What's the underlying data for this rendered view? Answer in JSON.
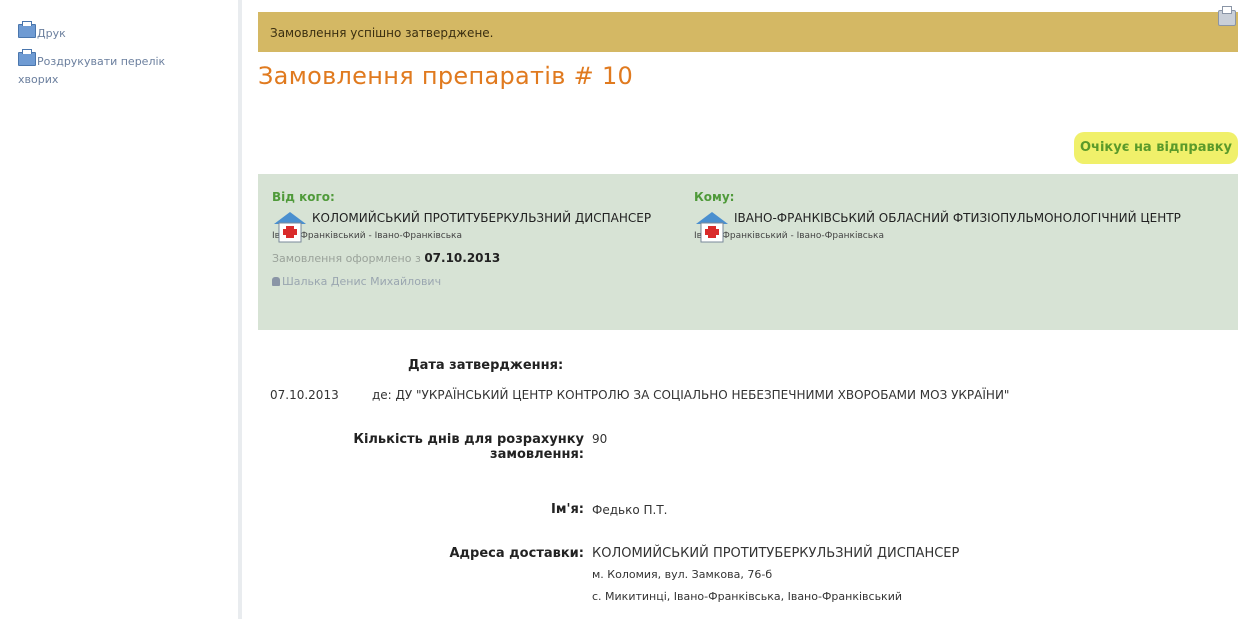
{
  "sidebar": {
    "print_label": "Друк",
    "print_animals_label": "Роздрукувати перелік хворих"
  },
  "notice": "Замовлення успішно затверджене.",
  "page_title": "Замовлення препаратів # 10",
  "status": "Очікує на відправку",
  "from": {
    "label": "Від кого:",
    "org": "КОЛОМИЙСЬКИЙ ПРОТИТУБЕРКУЛЬЗНИЙ ДИСПАНСЕР",
    "region": "Івано-Франківський - Івано-Франківська",
    "date_prefix": "Замовлення оформлено з",
    "date": "07.10.2013",
    "author": "Шалька Денис Михайлович"
  },
  "to": {
    "label": "Кому:",
    "org": "ІВАНО-ФРАНКІВСЬКИЙ ОБЛАСНИЙ ФТИЗІОПУЛЬМОНОЛОГІЧНИЙ ЦЕНТР",
    "region": "Івано-Франківський - Івано-Франківська"
  },
  "details": {
    "approval_date_label": "Дата затвердження:",
    "approval_date": "07.10.2013",
    "approval_by": "де: ДУ \"УКРАЇНСЬКИЙ ЦЕНТР КОНТРОЛЮ ЗА СОЦІАЛЬНО НЕБЕЗПЕЧНИМИ ХВОРОБАМИ МОЗ УКРАЇНИ\"",
    "days_label_line1": "Кількість днів для розрахунку",
    "days_label_line2": "замовлення:",
    "days_value": "90",
    "name_label": "Ім'я:",
    "name_value": "Федько П.Т.",
    "address_label": "Адреса доставки:",
    "address_line1": "КОЛОМИЙСЬКИЙ ПРОТИТУБЕРКУЛЬЗНИЙ ДИСПАНСЕР",
    "address_line2": "м. Коломия, вул. Замкова, 76-б",
    "address_line3": "с. Микитинці, Івано-Франківська, Івано-Франківський"
  },
  "colors": {
    "accent": "#e07a1f",
    "notice_bg": "#d4b864",
    "status_bg": "#f0f06a",
    "status_text": "#5a9a2a",
    "panel_bg": "#d7e3d5",
    "label_green": "#4f9a3a"
  }
}
